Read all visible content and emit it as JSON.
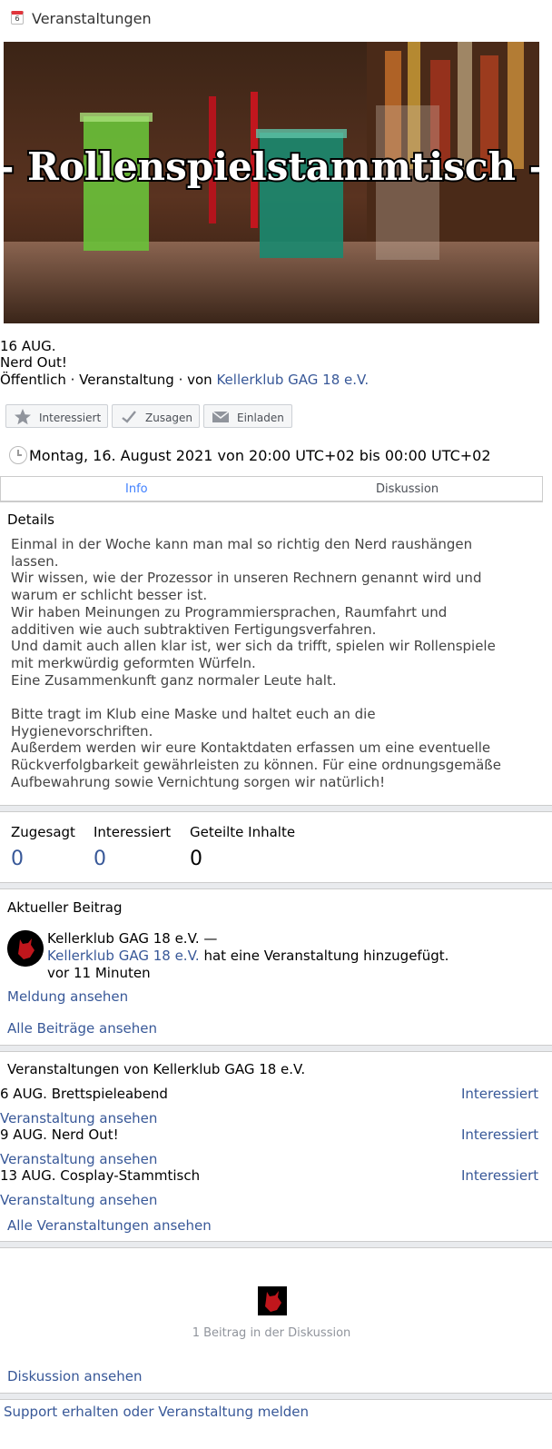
{
  "header": {
    "icon": "calendar-icon",
    "calendar_day": "6",
    "title": "Veranstaltungen"
  },
  "banner": {
    "text": "- Rollenspielstammtisch -"
  },
  "event": {
    "date": "16 AUG.",
    "name": "Nerd Out!",
    "meta_prefix": "Öffentlich · Veranstaltung · von ",
    "organizer": "Kellerklub GAG 18 e.V."
  },
  "actions": {
    "interested": "Interessiert",
    "going": "Zusagen",
    "invite": "Einladen"
  },
  "time": "Montag, 16. August 2021 von 20:00 UTC+02 bis 00:00 UTC+02",
  "tabs": {
    "info": "Info",
    "discussion": "Diskussion"
  },
  "details": {
    "title": "Details",
    "lines": [
      "Einmal in der Woche kann man mal so richtig den Nerd raushängen",
      "lassen.",
      "Wir wissen, wie der Prozessor in unseren Rechnern genannt wird und",
      "warum er schlicht besser ist.",
      "Wir haben Meinungen zu Programmiersprachen, Raumfahrt und",
      "additiven wie auch subtraktiven Fertigungsverfahren.",
      "Und damit auch allen klar ist, wer sich da trifft, spielen wir Rollenspiele",
      "mit merkwürdig geformten Würfeln.",
      "Eine Zusammenkunft ganz normaler Leute halt.",
      "",
      "Bitte tragt im Klub eine Maske und haltet euch an die",
      "Hygienevorschriften.",
      "Außerdem werden wir eure Kontaktdaten erfassen um eine eventuelle",
      "Rückverfolgbarkeit gewährleisten zu können. Für eine ordnungsgemäße",
      "Aufbewahrung sowie Vernichtung sorgen wir natürlich!"
    ]
  },
  "stats": {
    "going_label": "Zugesagt",
    "going_value": "0",
    "interested_label": "Interessiert",
    "interested_value": "0",
    "shared_label": "Geteilte Inhalte",
    "shared_value": "0"
  },
  "recent": {
    "title": "Aktueller Beitrag",
    "author": "Kellerklub GAG 18 e.V. —",
    "actor": "Kellerklub GAG 18 e.V.",
    "action": " hat eine Veranstaltung hinzugefügt.",
    "time": "vor 11 Minuten",
    "view_post": "Meldung ansehen",
    "all_posts": "Alle Beiträge ansehen"
  },
  "more_events": {
    "title": "Veranstaltungen von Kellerklub GAG 18 e.V.",
    "items": [
      {
        "date": "6 AUG.",
        "name": "Brettspieleabend",
        "interested": "Interessiert",
        "view": "Veranstaltung ansehen"
      },
      {
        "date": "9 AUG.",
        "name": "Nerd Out!",
        "interested": "Interessiert",
        "view": "Veranstaltung ansehen"
      },
      {
        "date": "13 AUG.",
        "name": "Cosplay-Stammtisch",
        "interested": "Interessiert",
        "view": "Veranstaltung ansehen"
      }
    ],
    "all_events": "Alle Veranstaltungen ansehen"
  },
  "discussion": {
    "count_text": "1 Beitrag in der Diskussion",
    "view": "Diskussion ansehen"
  },
  "footer": {
    "support": "Support erhalten oder Veranstaltung melden"
  },
  "colors": {
    "link": "#385898",
    "tab_active": "#4080ff",
    "separator": "#e9ebee"
  }
}
